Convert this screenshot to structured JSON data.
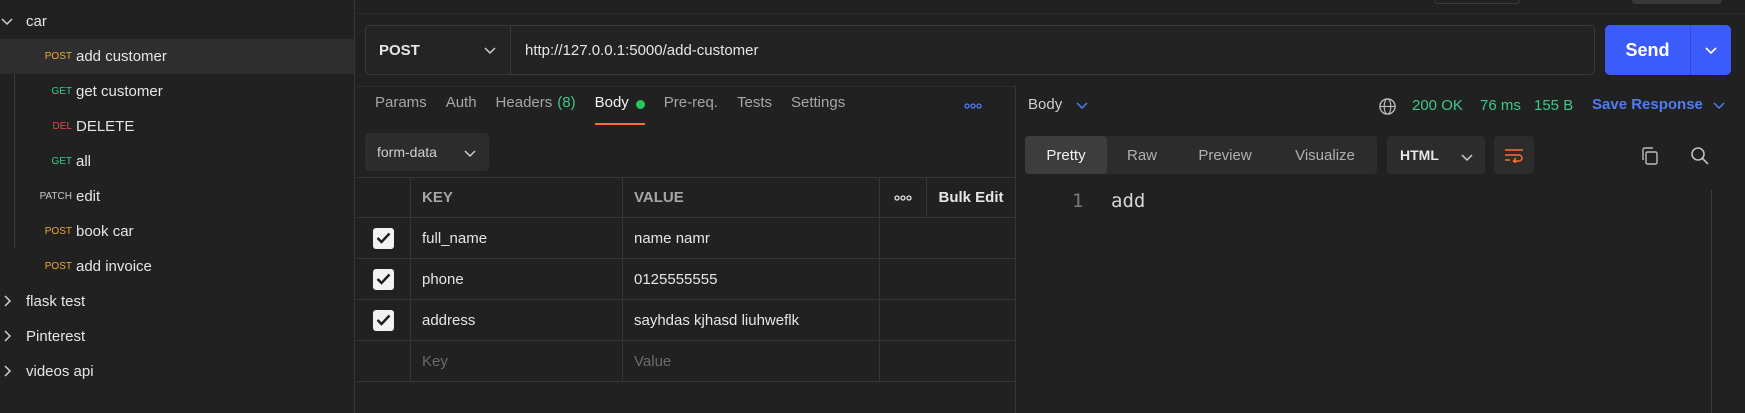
{
  "sidebar": {
    "collections": [
      {
        "name": "car",
        "expanded": true
      },
      {
        "name": "flask test",
        "expanded": false
      },
      {
        "name": "Pinterest",
        "expanded": false
      },
      {
        "name": "videos api",
        "expanded": false
      }
    ],
    "requests": [
      {
        "method": "POST",
        "name": "add customer",
        "method_color": "#e8a93a",
        "active": true
      },
      {
        "method": "GET",
        "name": "get customer",
        "method_color": "#3fc785"
      },
      {
        "method": "DEL",
        "name": "DELETE",
        "method_color": "#e5484d"
      },
      {
        "method": "GET",
        "name": "all",
        "method_color": "#3fc785"
      },
      {
        "method": "PATCH",
        "name": "edit",
        "method_color": "#c8c8c8"
      },
      {
        "method": "POST",
        "name": "book car",
        "method_color": "#e8a93a"
      },
      {
        "method": "POST",
        "name": "add invoice",
        "method_color": "#e8a93a"
      }
    ]
  },
  "request": {
    "method": "POST",
    "url": "http://127.0.0.1:5000/add-customer",
    "send_label": "Send",
    "tabs": [
      {
        "label": "Params"
      },
      {
        "label": "Auth"
      },
      {
        "label": "Headers",
        "count": "(8)"
      },
      {
        "label": "Body",
        "active": true
      },
      {
        "label": "Pre-req."
      },
      {
        "label": "Tests"
      },
      {
        "label": "Settings"
      }
    ],
    "body_type": "form-data",
    "table": {
      "headers": {
        "key": "KEY",
        "value": "VALUE",
        "bulk_edit": "Bulk Edit"
      },
      "rows": [
        {
          "key": "full_name",
          "value": "name namr",
          "checked": true
        },
        {
          "key": "phone",
          "value": "0125555555",
          "checked": true
        },
        {
          "key": "address",
          "value": "sayhdas kjhasd liuhweflk",
          "checked": true
        }
      ],
      "placeholder_key": "Key",
      "placeholder_value": "Value"
    }
  },
  "response": {
    "body_label": "Body",
    "status": "200 OK",
    "time": "76 ms",
    "size": "155 B",
    "save_label": "Save Response",
    "view_tabs": [
      "Pretty",
      "Raw",
      "Preview",
      "Visualize"
    ],
    "active_view": "Pretty",
    "language": "HTML",
    "lines": [
      {
        "num": "1",
        "text": "add"
      }
    ]
  },
  "colors": {
    "accent": "#ff6c37",
    "send": "#3b5bfb",
    "success": "#3fc785",
    "link": "#4d7cf5"
  }
}
